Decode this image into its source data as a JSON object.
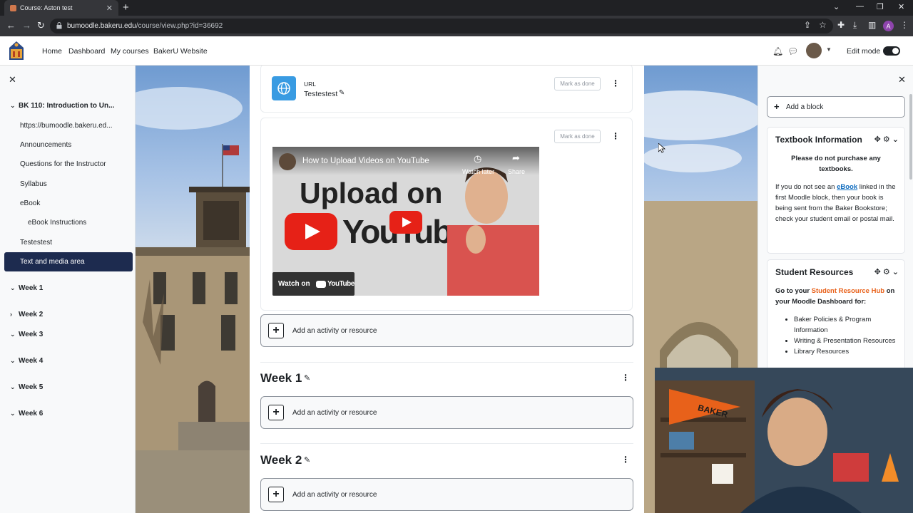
{
  "browser": {
    "tab_title": "Course: Aston test",
    "url_host": "bumoodle.bakeru.edu",
    "url_path": "/course/view.php?id=36692",
    "profile_initial": "A"
  },
  "navbar": {
    "links": [
      "Home",
      "Dashboard",
      "My courses",
      "BakerU Website"
    ],
    "edit_mode_label": "Edit mode"
  },
  "course_index": {
    "course_title": "BK 110: Introduction to Un...",
    "items": [
      "https://bumoodle.bakeru.ed...",
      "Announcements",
      "Questions for the Instructor",
      "Syllabus",
      "eBook",
      "eBook Instructions",
      "Testestest"
    ],
    "active_item": "Text and media area",
    "sections": [
      "Week 1",
      "Week 2",
      "Week 3",
      "Week 4",
      "Week 5",
      "Week 6"
    ]
  },
  "main": {
    "url_activity": {
      "type_label": "URL",
      "name": "Testestest"
    },
    "mark_as_done": "Mark as done",
    "video": {
      "title": "How to Upload Videos on YouTube",
      "headline_line1": "Upload on",
      "headline_line2": "YouTube",
      "watch_later": "Watch later",
      "share": "Share",
      "watch_on": "Watch on",
      "youtube": "YouTube"
    },
    "add_activity": "Add an activity or resource",
    "week1_title": "Week 1",
    "week2_title": "Week 2"
  },
  "blocks": {
    "add_block": "Add a block",
    "textbook": {
      "title": "Textbook Information",
      "bold_notice": "Please do not purchase any textbooks.",
      "body_pre": "If you do not see an ",
      "body_link": "eBook",
      "body_post": " linked in the first Moodle block, then your book is being sent from the Baker Bookstore; check your student email or postal mail."
    },
    "resources": {
      "title": "Student Resources",
      "intro_pre": "Go to your ",
      "intro_link": "Student Resource Hub",
      "intro_post": " on your Moodle Dashboard for:",
      "list": [
        "Baker Policies & Program Information",
        "Writing & Presentation Resources",
        "Library Resources"
      ]
    }
  },
  "webcam": {
    "pennant_text": "BAKER"
  },
  "colors": {
    "accent": "#1d2b4f",
    "link": "#0f6cbf",
    "resource_link": "#e8611a",
    "url_icon": "#399be2"
  }
}
